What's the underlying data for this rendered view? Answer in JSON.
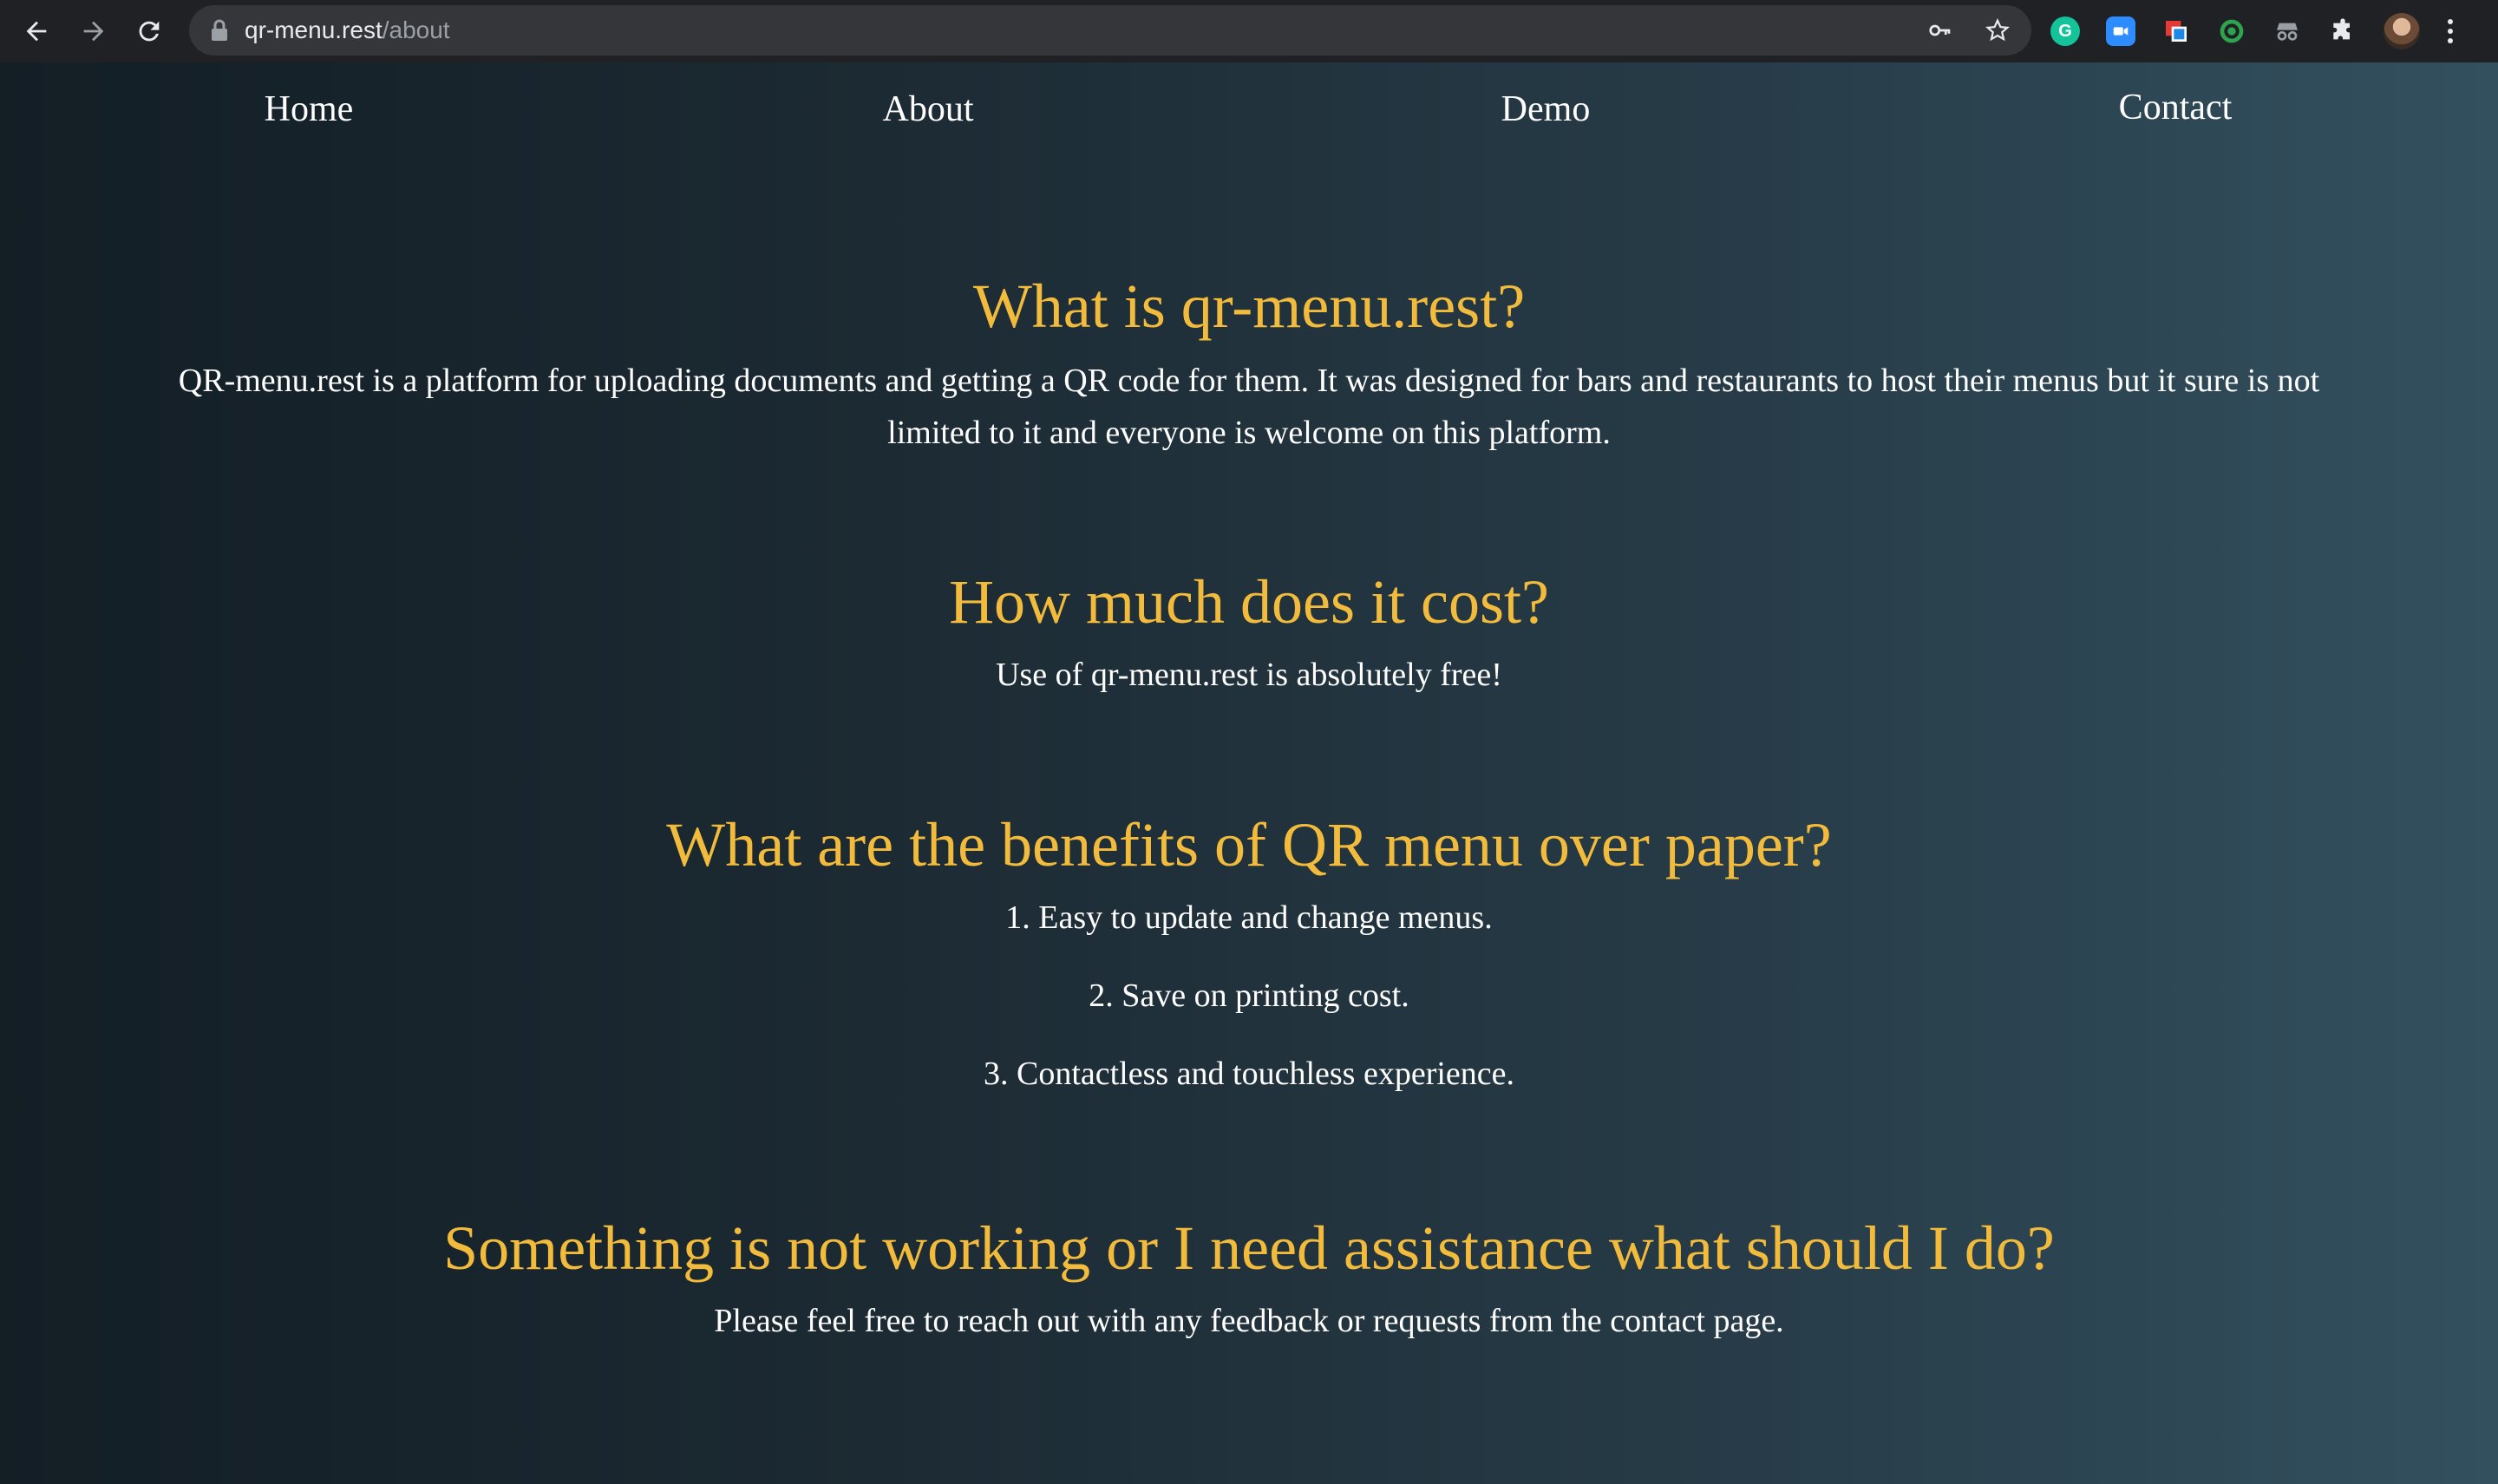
{
  "browser": {
    "url_domain": "qr-menu.rest",
    "url_path": "/about",
    "extensions": [
      {
        "icon": "grammarly-icon",
        "letter": "G",
        "color": "#15c39a"
      },
      {
        "icon": "zoom-icon",
        "letter": "",
        "color": "#2d8cff"
      },
      {
        "icon": "copy-icon",
        "letter": "",
        "color": "#e53935"
      },
      {
        "icon": "target-icon",
        "letter": "",
        "color": "#2ea44f"
      },
      {
        "icon": "incognito-ext-icon",
        "letter": "",
        "color": "#9aa0a6"
      },
      {
        "icon": "puzzle-icon",
        "letter": "",
        "color": "#e8eaed"
      }
    ]
  },
  "nav": {
    "home": "Home",
    "about": "About",
    "demo": "Demo",
    "contact": "Contact"
  },
  "sections": [
    {
      "heading": "What is qr-menu.rest?",
      "body": "QR-menu.rest is a platform for uploading documents and getting a QR code for them. It was designed for bars and restaurants to host their menus but it sure is not limited to it and everyone is welcome on this platform."
    },
    {
      "heading": "How much does it cost?",
      "body": "Use of qr-menu.rest is absolutely free!"
    },
    {
      "heading": "What are the benefits of QR menu over paper?",
      "items": [
        "1. Easy to update and change menus.",
        "2. Save on printing cost.",
        "3. Contactless and touchless experience."
      ]
    },
    {
      "heading": "Something is not working or I need assistance what should I do?",
      "body": "Please feel free to reach out with any feedback or requests from the contact page."
    }
  ],
  "colors": {
    "heading": "#f2bb3b",
    "text": "#ffffff",
    "background_left": "#131e25",
    "background_right": "#33505f"
  }
}
